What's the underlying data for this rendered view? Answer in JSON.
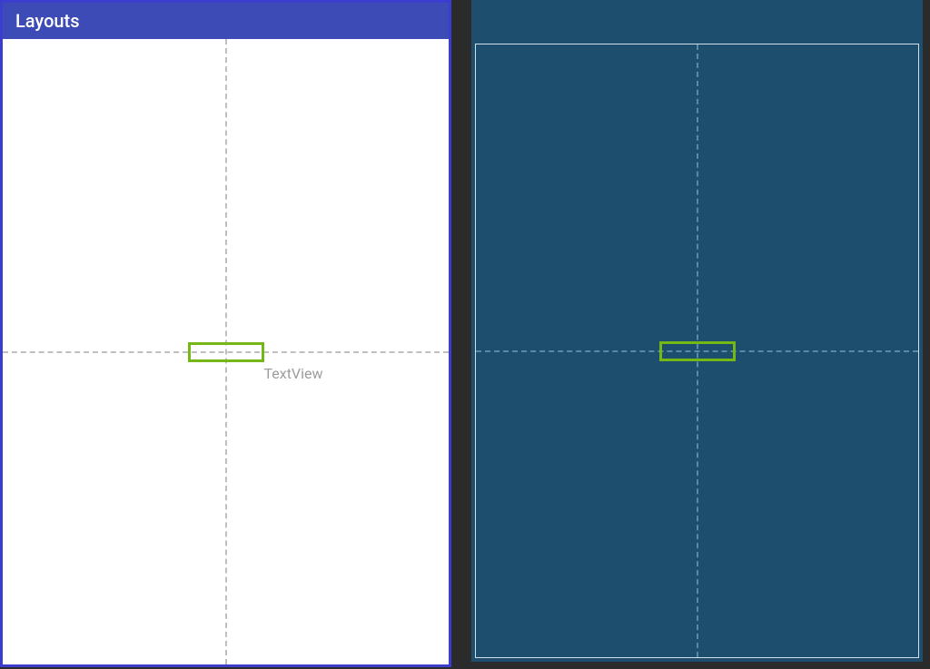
{
  "app_bar": {
    "title": "Layouts"
  },
  "selected_component": {
    "type_label": "TextView"
  },
  "colors": {
    "accent_purple": "#3d4bb7",
    "selection_green": "#74b816",
    "blueprint_bg": "#1d4e6e"
  }
}
